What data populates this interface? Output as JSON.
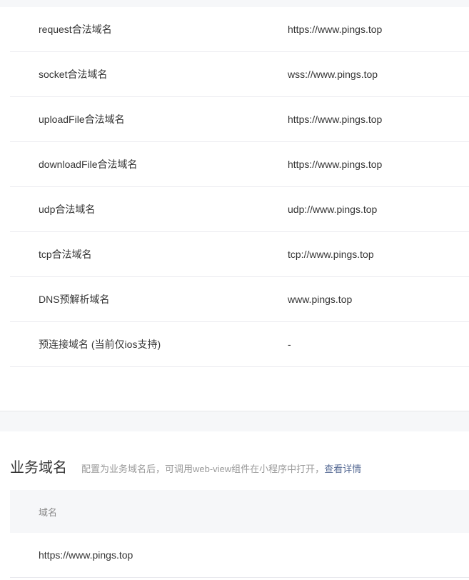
{
  "server_domains": [
    {
      "label": "request合法域名",
      "value": "https://www.pings.top"
    },
    {
      "label": "socket合法域名",
      "value": "wss://www.pings.top"
    },
    {
      "label": "uploadFile合法域名",
      "value": "https://www.pings.top"
    },
    {
      "label": "downloadFile合法域名",
      "value": "https://www.pings.top"
    },
    {
      "label": "udp合法域名",
      "value": "udp://www.pings.top"
    },
    {
      "label": "tcp合法域名",
      "value": "tcp://www.pings.top"
    },
    {
      "label": "DNS预解析域名",
      "value": "www.pings.top"
    },
    {
      "label": "预连接域名 (当前仅ios支持)",
      "value": "-"
    }
  ],
  "business": {
    "title": "业务域名",
    "description": "配置为业务域名后，可调用web-view组件在小程序中打开，",
    "link": "查看详情",
    "column_header": "域名",
    "rows": [
      "https://www.pings.top"
    ]
  }
}
